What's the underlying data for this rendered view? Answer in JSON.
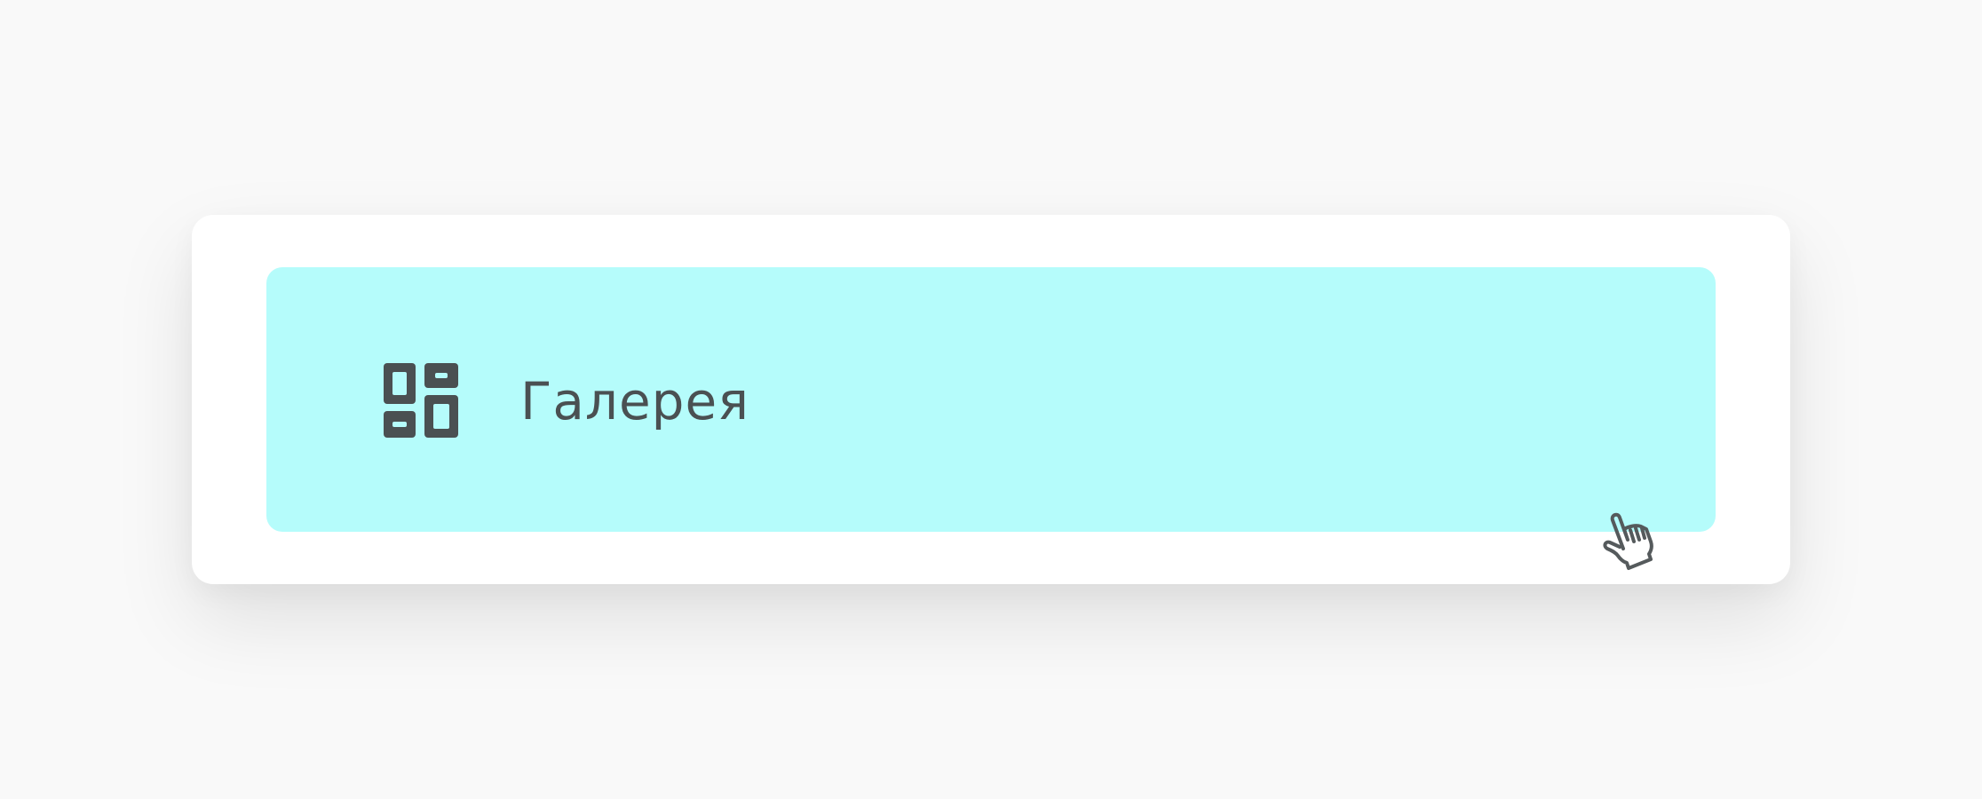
{
  "menu": {
    "gallery_item": {
      "label": "Галерея",
      "icon": "gallery-grid-icon",
      "state": "hovered"
    }
  },
  "colors": {
    "page_background": "#f9f9f9",
    "card_background": "#ffffff",
    "item_highlight": "#b5fcfb",
    "icon_and_text": "#4a5052"
  },
  "cursor": {
    "icon": "hand-pointer-cursor-icon"
  }
}
